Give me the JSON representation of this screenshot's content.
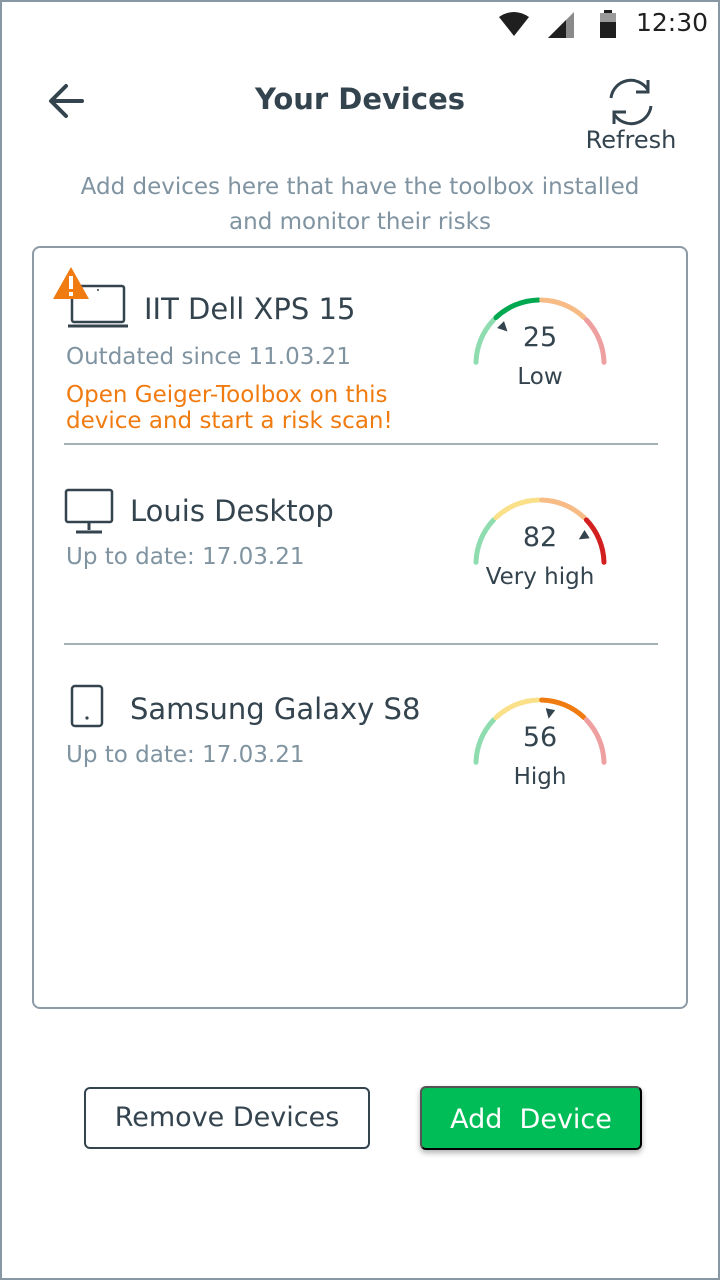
{
  "status_bar": {
    "time": "12:30",
    "icons": [
      "wifi-icon",
      "cell-signal-icon",
      "battery-icon"
    ]
  },
  "header": {
    "title": "Your Devices",
    "back_icon": "arrow-left-icon",
    "refresh_label": "Refresh",
    "refresh_icon": "refresh-icon"
  },
  "subtitle": "Add devices here that have the toolbox installed and monitor their risks",
  "devices": [
    {
      "name": "IIT Dell XPS 15",
      "icon": "laptop-icon",
      "warning_icon": "warning-triangle-icon",
      "status": "Outdated since 11.03.21",
      "warning": "Open Geiger-Toolbox on this device and start a risk scan!",
      "risk_value": "25",
      "risk_label": "Low",
      "risk_fraction": 0.25,
      "active_color": "#00a84f"
    },
    {
      "name": "Louis Desktop",
      "icon": "desktop-monitor-icon",
      "status": "Up to date: 17.03.21",
      "risk_value": "82",
      "risk_label": "Very high",
      "risk_fraction": 0.82,
      "active_color": "#d21f1f"
    },
    {
      "name": "Samsung Galaxy S8",
      "icon": "smartphone-icon",
      "status": "Up to date: 17.03.21",
      "risk_value": "56",
      "risk_label": "High",
      "risk_fraction": 0.56,
      "active_color": "#f07b10"
    }
  ],
  "buttons": {
    "remove_label": "Remove Devices",
    "add_label": "Add  Device"
  },
  "colors": {
    "accent_green": "#00bd57",
    "warning_orange": "#f07b10",
    "text_dark": "#34444f",
    "text_muted": "#7f93a1"
  }
}
